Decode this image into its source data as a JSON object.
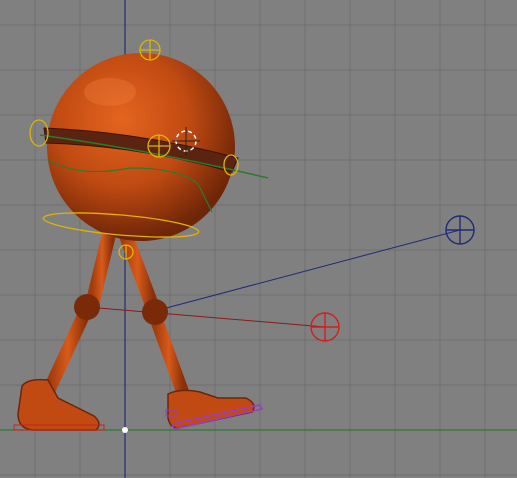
{
  "viewport": {
    "kind": "3d-side-orthographic-view",
    "background_color": "#808080",
    "grid_color": "#6f6f6f",
    "axis_colors": {
      "vertical": "#1f2f6e",
      "ground": "#2f7a2f"
    }
  },
  "character": {
    "body_color": "#c04a12",
    "shade_color": "#7a2a08",
    "belt_color": "#5a2410"
  },
  "rig": {
    "control_color": "#e0b400",
    "knee_target_left_color": "#1e2a78",
    "knee_target_right_color": "#d21e1e",
    "foot_control_color": "#9a3cc8",
    "cursor_color": "#ffffff"
  },
  "icons": [
    "grid-lines",
    "vertical-axis-line",
    "ground-axis-line",
    "body-sphere",
    "belt-band",
    "leg-joints",
    "feet",
    "yellow-rotation-controls",
    "blue-pole-target",
    "red-pole-target",
    "3d-cursor-icon",
    "origin-point-icon"
  ]
}
